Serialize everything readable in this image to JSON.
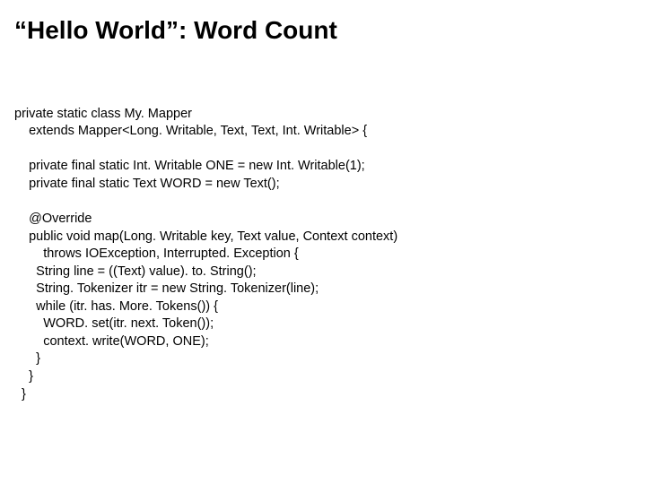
{
  "title": "“Hello World”: Word Count",
  "code": {
    "l01": "private static class My. Mapper",
    "l02": "    extends Mapper<Long. Writable, Text, Text, Int. Writable> {",
    "l03": "",
    "l04": "    private final static Int. Writable ONE = new Int. Writable(1);",
    "l05": "    private final static Text WORD = new Text();",
    "l06": "",
    "l07": "    @Override",
    "l08": "    public void map(Long. Writable key, Text value, Context context)",
    "l09": "        throws IOException, Interrupted. Exception {",
    "l10": "      String line = ((Text) value). to. String();",
    "l11": "      String. Tokenizer itr = new String. Tokenizer(line);",
    "l12": "      while (itr. has. More. Tokens()) {",
    "l13": "        WORD. set(itr. next. Token());",
    "l14": "        context. write(WORD, ONE);",
    "l15": "      }",
    "l16": "    }",
    "l17": "  }"
  }
}
